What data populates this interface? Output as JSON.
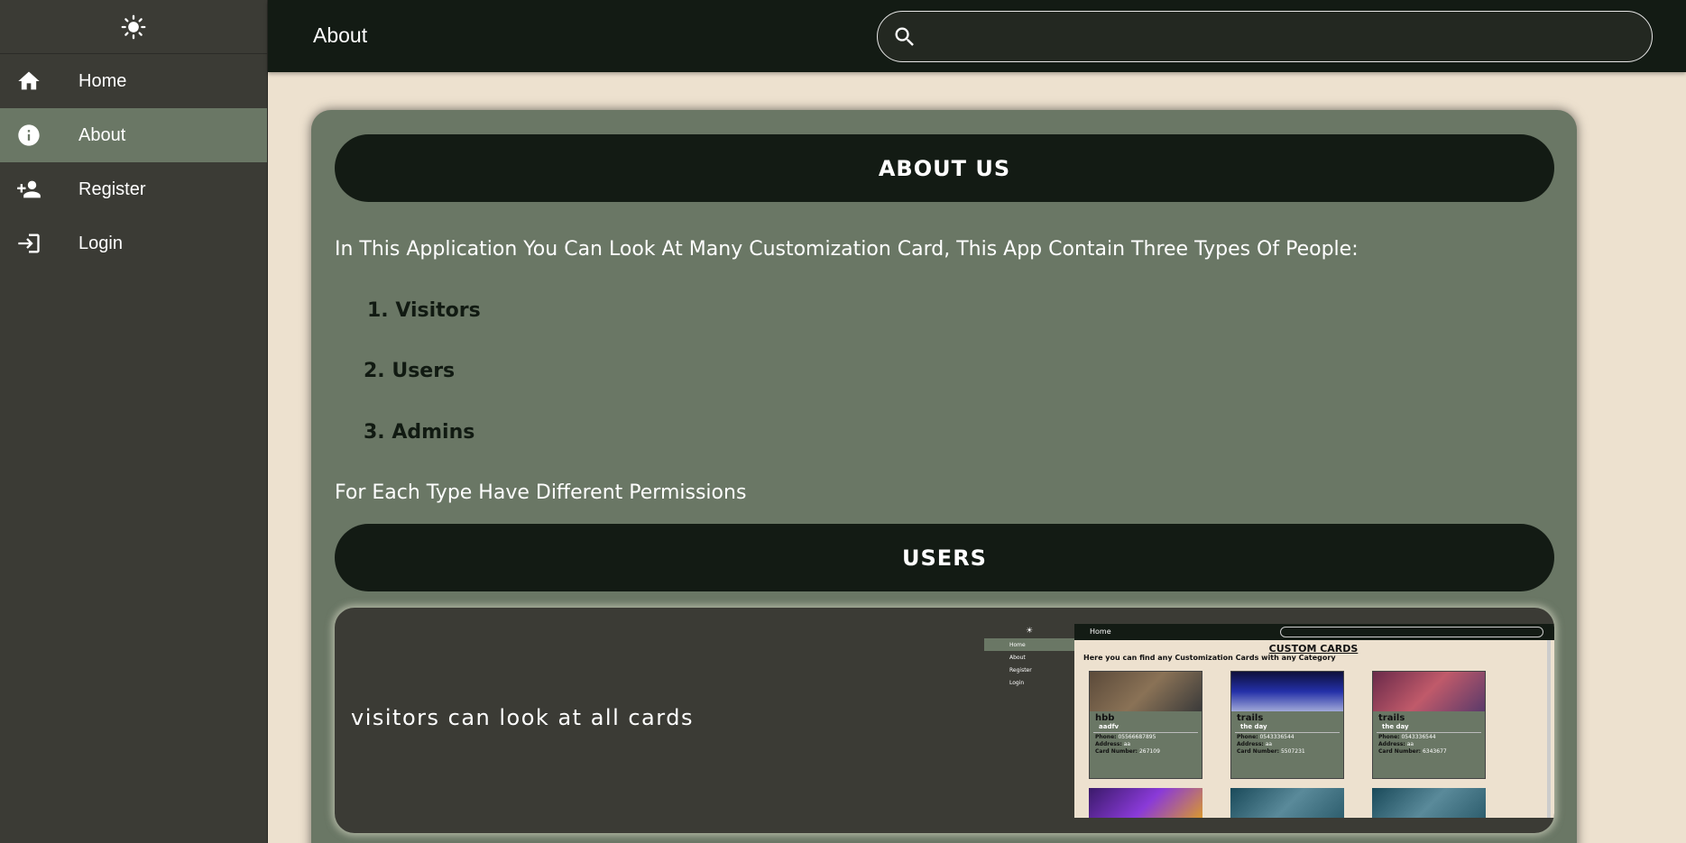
{
  "sidebar": {
    "theme_icon": "sun-icon",
    "items": [
      {
        "label": "Home",
        "icon": "home-icon",
        "active": false
      },
      {
        "label": "About",
        "icon": "info-icon",
        "active": true
      },
      {
        "label": "Register",
        "icon": "add-user-icon",
        "active": false
      },
      {
        "label": "Login",
        "icon": "login-icon",
        "active": false
      }
    ]
  },
  "header": {
    "title": "About",
    "search_placeholder": ""
  },
  "about": {
    "heading": "ABOUT US",
    "intro": "In This Application You Can Look At Many Customization Card, This App Contain Three Types Of People:",
    "types": [
      "1. Visitors",
      "2. Users",
      "3. Admins"
    ],
    "permissions_text": "For Each Type Have Different Permissions",
    "users_heading": "USERS",
    "feature_text": "visitors can look at all cards"
  },
  "thumbnail": {
    "page_title": "Home",
    "nav": [
      "Home",
      "About",
      "Register",
      "Login"
    ],
    "heading": "CUSTOM CARDS",
    "subheading": "Here you can find any Customization Cards with any Category",
    "cards": [
      {
        "title": "hbb",
        "subtitle": "aadfv",
        "phone": "05566687895",
        "address": "aa",
        "card_number": "267109"
      },
      {
        "title": "trails",
        "subtitle": "the day",
        "phone": "0543336544",
        "address": "aa",
        "card_number": "5507231"
      },
      {
        "title": "trails",
        "subtitle": "the day",
        "phone": "0543336544",
        "address": "aa",
        "card_number": "6343677"
      }
    ],
    "labels": {
      "phone": "Phone:",
      "address": "Address:",
      "card_number": "Card Number:"
    }
  },
  "colors": {
    "sidebar_bg": "#3b3b35",
    "active_bg": "#6a7765",
    "topbar_bg": "#131b14",
    "page_bg": "#ede1cf",
    "card_bg": "#6a7765"
  }
}
